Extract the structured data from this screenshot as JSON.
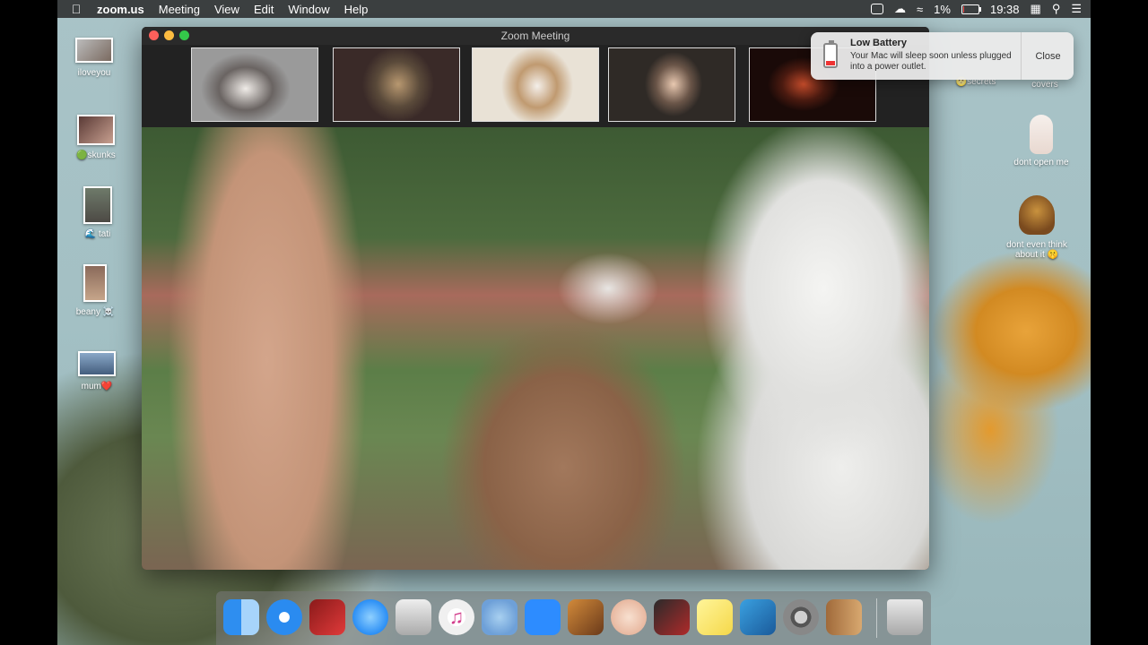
{
  "menubar": {
    "app_name": "zoom.us",
    "menus": [
      "Meeting",
      "View",
      "Edit",
      "Window",
      "Help"
    ],
    "battery_percent": "1%",
    "clock": "19:38"
  },
  "window": {
    "title": "Zoom Meeting"
  },
  "notification": {
    "title": "Low Battery",
    "body": "Your Mac will sleep soon unless plugged into a power outlet.",
    "close_label": "Close"
  },
  "desktop_icons_left": [
    {
      "label": "iloveyou"
    },
    {
      "label": "🟢skunks"
    },
    {
      "label": "🌊 tati"
    },
    {
      "label": "beany ☠️"
    },
    {
      "label": "mum❤️"
    }
  ],
  "desktop_icons_right": [
    {
      "label": "🌝secrets"
    },
    {
      "label": "covers"
    },
    {
      "label": "dont open me"
    },
    {
      "label": "dont even think about it 🤫"
    }
  ],
  "dock": {
    "apps": [
      "Finder",
      "Safari",
      "Photo Booth",
      "Messages",
      "Inkscape",
      "iTunes",
      "Sequel Pro",
      "Zoom",
      "GarageBand",
      "Messages Face",
      "Photo Editor",
      "Stickies",
      "Preview",
      "System Preferences",
      "Contacts",
      "Trash"
    ]
  },
  "battery_level": 0.01
}
